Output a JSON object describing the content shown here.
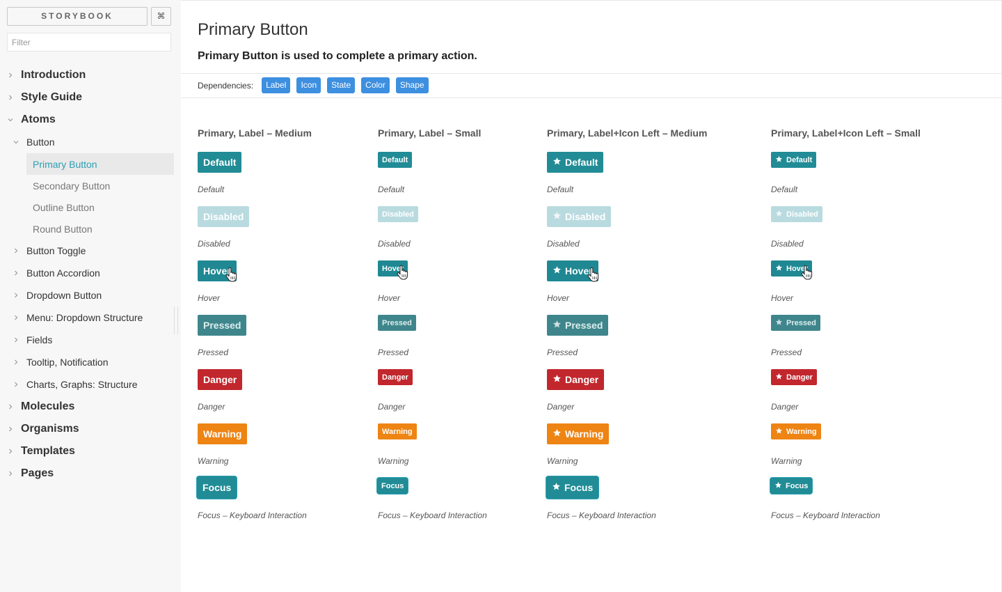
{
  "app": {
    "brand": "STORYBOOK",
    "shortcut_icon": "command-icon",
    "shortcut_label": "⌘",
    "filter_placeholder": "Filter"
  },
  "sidebar": {
    "items": [
      {
        "label": "Introduction",
        "level": 0,
        "expanded": false
      },
      {
        "label": "Style Guide",
        "level": 0,
        "expanded": false
      },
      {
        "label": "Atoms",
        "level": 0,
        "expanded": true
      },
      {
        "label": "Button",
        "level": 1,
        "expanded": true
      },
      {
        "label": "Primary Button",
        "level": 2,
        "active": true
      },
      {
        "label": "Secondary Button",
        "level": 2
      },
      {
        "label": "Outline Button",
        "level": 2
      },
      {
        "label": "Round Button",
        "level": 2
      },
      {
        "label": "Button Toggle",
        "level": 1,
        "expanded": false
      },
      {
        "label": "Button Accordion",
        "level": 1,
        "expanded": false
      },
      {
        "label": "Dropdown Button",
        "level": 1,
        "expanded": false
      },
      {
        "label": "Menu: Dropdown Structure",
        "level": 1,
        "expanded": false
      },
      {
        "label": "Fields",
        "level": 1,
        "expanded": false
      },
      {
        "label": "Tooltip, Notification",
        "level": 1,
        "expanded": false
      },
      {
        "label": "Charts, Graphs: Structure",
        "level": 1,
        "expanded": false
      },
      {
        "label": "Molecules",
        "level": 0,
        "expanded": false
      },
      {
        "label": "Organisms",
        "level": 0,
        "expanded": false
      },
      {
        "label": "Templates",
        "level": 0,
        "expanded": false
      },
      {
        "label": "Pages",
        "level": 0,
        "expanded": false
      }
    ]
  },
  "main": {
    "title": "Primary Button",
    "subtitle": "Primary Button is used to complete a primary action.",
    "dependencies_label": "Dependencies:",
    "dependencies": [
      "Label",
      "Icon",
      "State",
      "Color",
      "Shape"
    ],
    "columns": [
      {
        "title": "Primary, Label – Medium",
        "size": "md",
        "icon": false
      },
      {
        "title": "Primary, Label – Small",
        "size": "sm",
        "icon": false
      },
      {
        "title": "Primary, Label+Icon Left – Medium",
        "size": "md",
        "icon": true
      },
      {
        "title": "Primary, Label+Icon Left – Small",
        "size": "sm",
        "icon": true
      }
    ],
    "states": [
      {
        "button": "Default",
        "caption": "Default",
        "variant": "default"
      },
      {
        "button": "Disabled",
        "caption": "Disabled",
        "variant": "disabled"
      },
      {
        "button": "Hover",
        "caption": "Hover",
        "variant": "hover"
      },
      {
        "button": "Pressed",
        "caption": "Pressed",
        "variant": "pressed"
      },
      {
        "button": "Danger",
        "caption": "Danger",
        "variant": "danger"
      },
      {
        "button": "Warning",
        "caption": "Warning",
        "variant": "warning"
      },
      {
        "button": "Focus",
        "caption": "Focus – Keyboard Interaction",
        "variant": "focus"
      }
    ],
    "icon": "star-icon",
    "hover_cursor_icon": "hand-pointer-icon"
  },
  "colors": {
    "default": "#218c96",
    "disabled": "#b9dbe0",
    "hover": "#1f8893",
    "pressed": "#3f868c",
    "danger": "#c1272d",
    "warning": "#ee8413",
    "focus": "#218c96",
    "focus_ring": "#2aa0b3",
    "active_nav": "#2aa0b3",
    "chip": "#3d8fe0"
  }
}
